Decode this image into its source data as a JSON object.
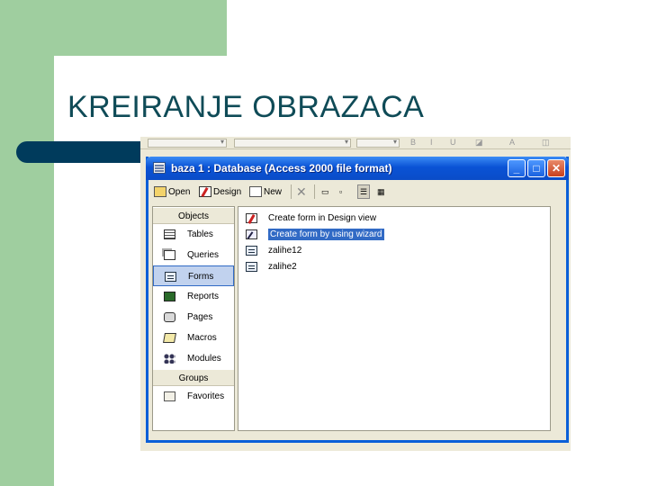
{
  "slide": {
    "title": "KREIRANJE OBRAZACA"
  },
  "window": {
    "title": "baza 1 : Database (Access 2000 file format)",
    "controls": {
      "minimize": "_",
      "maximize": "□",
      "close": "✕"
    }
  },
  "toolbar": {
    "open_label": "Open",
    "design_label": "Design",
    "new_label": "New"
  },
  "objects": {
    "header": "Objects",
    "items": [
      {
        "label": "Tables",
        "icon": "table-icon"
      },
      {
        "label": "Queries",
        "icon": "query-icon"
      },
      {
        "label": "Forms",
        "icon": "form-icon",
        "selected": true
      },
      {
        "label": "Reports",
        "icon": "report-icon"
      },
      {
        "label": "Pages",
        "icon": "page-icon"
      },
      {
        "label": "Macros",
        "icon": "macro-icon"
      },
      {
        "label": "Modules",
        "icon": "module-icon"
      }
    ],
    "groups_header": "Groups",
    "groups": [
      {
        "label": "Favorites",
        "icon": "favorites-icon"
      }
    ]
  },
  "forms_list": [
    {
      "label": "Create form in Design view",
      "icon": "design-view-icon"
    },
    {
      "label": "Create form by using wizard",
      "icon": "wizard-icon",
      "selected": true
    },
    {
      "label": "zalihe12",
      "icon": "form-icon"
    },
    {
      "label": "zalihe2",
      "icon": "form-icon"
    }
  ],
  "colors": {
    "accent_green": "#9fce9f",
    "title_color": "#0f4b57",
    "xp_blue": "#0a53d5",
    "selection": "#316ac5"
  }
}
